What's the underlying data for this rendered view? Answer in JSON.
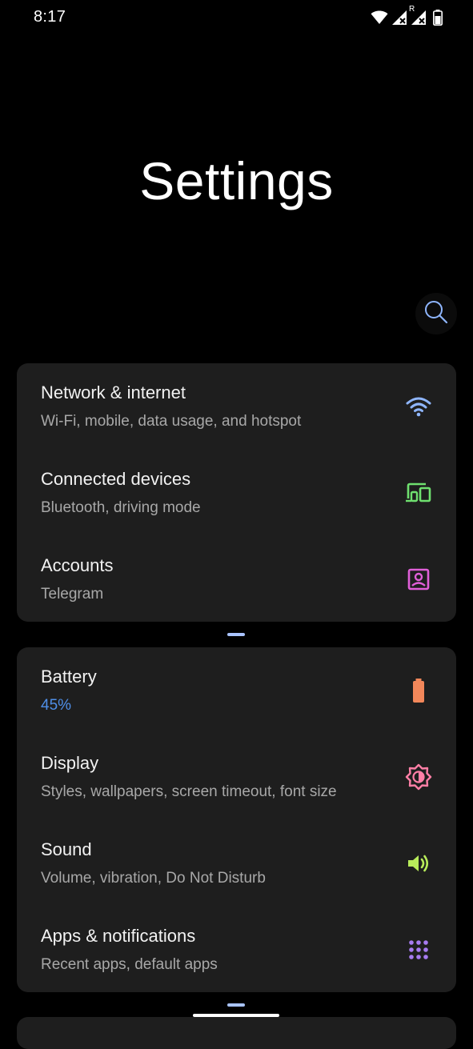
{
  "status_bar": {
    "time": "8:17",
    "roaming_label": "R",
    "icons": [
      "wifi-icon",
      "signal-no-data-icon",
      "signal-roaming-icon",
      "battery-icon"
    ]
  },
  "header": {
    "title": "Settings",
    "search_icon": "search-icon"
  },
  "groups": [
    {
      "items": [
        {
          "title": "Network & internet",
          "summary": "Wi-Fi, mobile, data usage, and hotspot",
          "icon": "wifi-icon",
          "icon_color": "#8fb6ff"
        },
        {
          "title": "Connected devices",
          "summary": "Bluetooth, driving mode",
          "icon": "devices-icon",
          "icon_color": "#6fe06f"
        },
        {
          "title": "Accounts",
          "summary": "Telegram",
          "icon": "account-box-icon",
          "icon_color": "#e05fd8"
        }
      ]
    },
    {
      "items": [
        {
          "title": "Battery",
          "summary": "45%",
          "icon": "battery-icon",
          "icon_color": "#f2875a",
          "level_percent": 45
        },
        {
          "title": "Display",
          "summary": "Styles, wallpapers, screen timeout, font size",
          "icon": "brightness-icon",
          "icon_color": "#ff7fa6"
        },
        {
          "title": "Sound",
          "summary": "Volume, vibration, Do Not Disturb",
          "icon": "volume-icon",
          "icon_color": "#b8ec5a"
        },
        {
          "title": "Apps & notifications",
          "summary": "Recent apps, default apps",
          "icon": "apps-grid-icon",
          "icon_color": "#a77bf0"
        }
      ]
    }
  ],
  "colors": {
    "background": "#000000",
    "card": "#1e1e1e",
    "accent": "#4f8fe8",
    "handle": "#aac4ff"
  }
}
